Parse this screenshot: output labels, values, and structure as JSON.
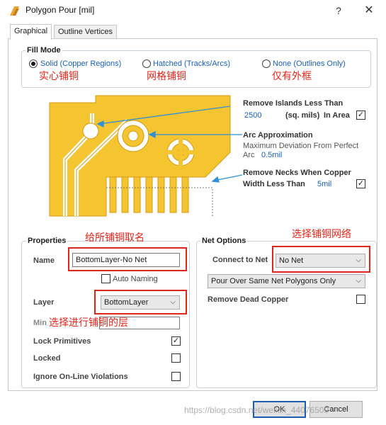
{
  "window": {
    "title": "Polygon Pour [mil]",
    "help": "?",
    "close": "✕"
  },
  "tabs": [
    {
      "label": "Graphical"
    },
    {
      "label": "Outline Vertices"
    }
  ],
  "fill_mode": {
    "title": "Fill Mode",
    "options": [
      {
        "label": "Solid (Copper Regions)",
        "checked": true,
        "note": "实心铺铜"
      },
      {
        "label": "Hatched (Tracks/Arcs)",
        "checked": false,
        "note": "网格铺铜"
      },
      {
        "label": "None (Outlines Only)",
        "checked": false,
        "note": "仅有外框"
      }
    ]
  },
  "preview": {
    "remove_islands": {
      "line1": "Remove Islands Less Than",
      "value": "2500",
      "unit": "(sq. mils)",
      "suffix": "In Area",
      "checked": true
    },
    "arc_approx": {
      "title": "Arc Approximation",
      "line1": "Maximum Deviation From Perfect",
      "prefix": "Arc",
      "value": "0.5mil"
    },
    "remove_necks": {
      "line1": "Remove Necks When Copper",
      "line2": "Width Less Than",
      "value": "5mil",
      "checked": true
    },
    "copper_color": "#f5c431"
  },
  "properties": {
    "title": "Properties",
    "note": "给所铺铜取名",
    "name_label": "Name",
    "name_value": "BottomLayer-No Net",
    "auto_naming": "Auto Naming",
    "auto_naming_checked": false,
    "layer_label": "Layer",
    "layer_value": "BottomLayer",
    "layer_note": "选择进行铺铜的层",
    "min_label": "Min",
    "lock_primitives": "Lock Primitives",
    "lock_primitives_checked": true,
    "locked": "Locked",
    "locked_checked": false,
    "ignore_violations": "Ignore On-Line Violations",
    "ignore_violations_checked": false
  },
  "net_options": {
    "title": "Net Options",
    "note": "选择铺铜网络",
    "connect_label": "Connect to Net",
    "connect_value": "No Net",
    "pour_value": "Pour Over Same Net Polygons Only",
    "remove_dead": "Remove Dead Copper",
    "remove_dead_checked": false
  },
  "buttons": {
    "ok": "OK",
    "cancel": "Cancel"
  },
  "watermark": "https://blog.csdn.net/weixin_44076509"
}
